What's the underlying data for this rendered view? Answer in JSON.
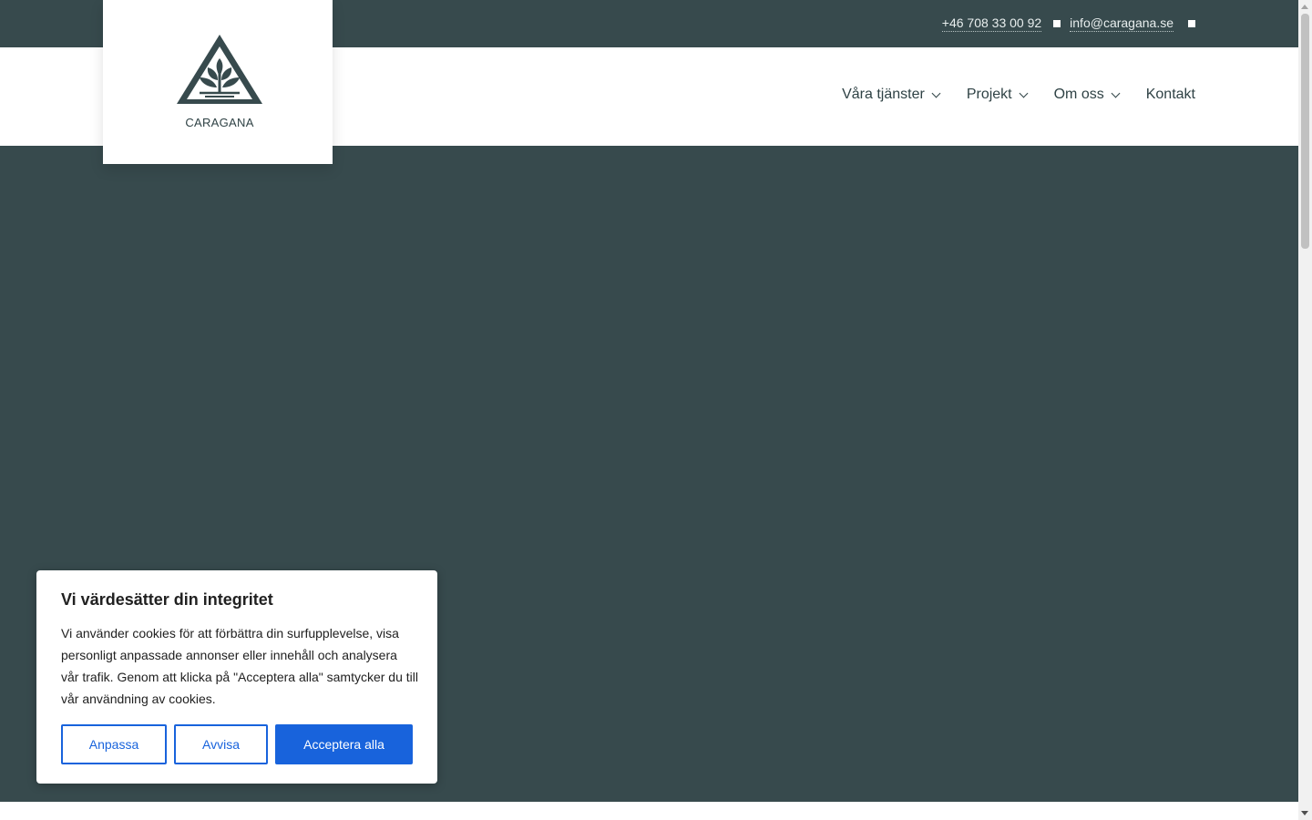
{
  "topbar": {
    "phone": "+46 708 33 00 92",
    "email": "info@caragana.se"
  },
  "logo": {
    "name": "CARAGANA"
  },
  "nav": {
    "items": [
      {
        "label": "Våra tjänster",
        "has_dropdown": true
      },
      {
        "label": "Projekt",
        "has_dropdown": true
      },
      {
        "label": "Om oss",
        "has_dropdown": true
      },
      {
        "label": "Kontakt",
        "has_dropdown": false
      }
    ]
  },
  "cookie_banner": {
    "title": "Vi värdesätter din integritet",
    "body": "Vi använder cookies för att förbättra din surfupplevelse, visa personligt anpassade annonser eller innehåll och analysera vår trafik. Genom att klicka på \"Acceptera alla\" samtycker du till vår användning av cookies.",
    "customize_label": "Anpassa",
    "reject_label": "Avvisa",
    "accept_label": "Acceptera alla"
  },
  "colors": {
    "brand_dark": "#374a4d",
    "accent_blue": "#1863dc"
  }
}
